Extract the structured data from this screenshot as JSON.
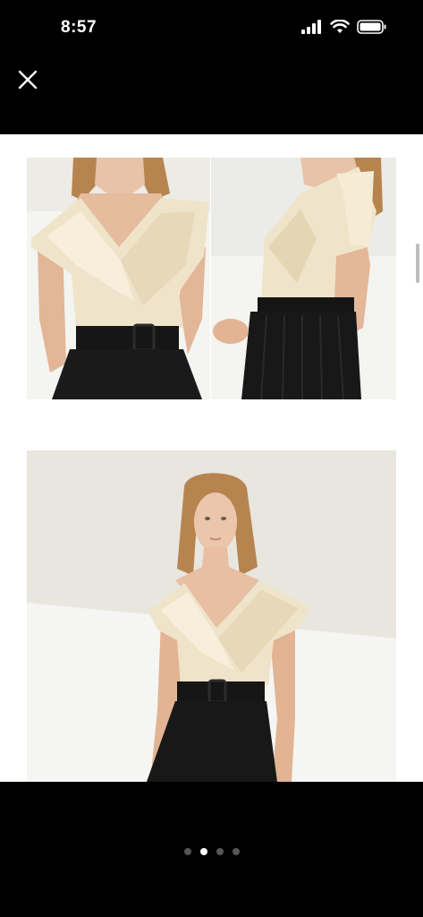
{
  "status_bar": {
    "time": "8:57",
    "icons": [
      "cellular-signal-icon",
      "wifi-icon",
      "battery-icon"
    ]
  },
  "toolbar": {
    "close_icon": "close-icon"
  },
  "gallery": {
    "images": [
      "product-photo-front-detail",
      "product-photo-side-detail",
      "product-photo-full-front"
    ],
    "page_count": 4,
    "current_page": 2
  },
  "colors": {
    "background": "#000000",
    "content_background": "#ffffff",
    "top_cream": "#efe4c9",
    "skirt_black": "#141414",
    "dot_active": "#ffffff",
    "dot_inactive": "#555555"
  }
}
